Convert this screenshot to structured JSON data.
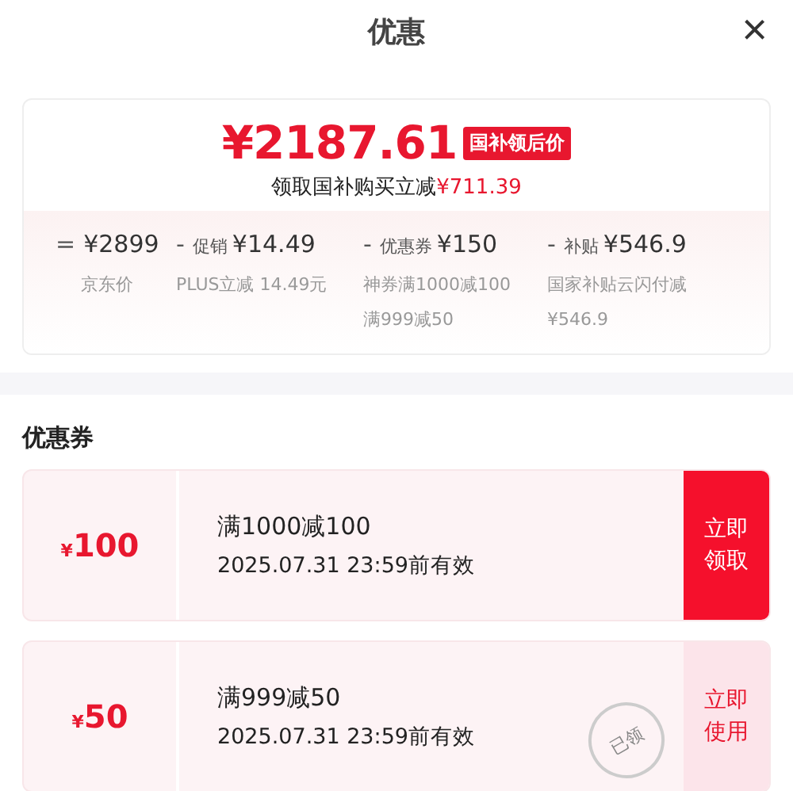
{
  "header": {
    "title": "优惠",
    "close": "×"
  },
  "summary": {
    "price": "¥2187.61",
    "badge": "国补领后价",
    "saving_text": "领取国补购买立减",
    "saving_amount": "¥711.39",
    "breakdown": [
      {
        "op": "=",
        "amount": "¥2899",
        "notes": [
          "京东价"
        ]
      },
      {
        "op": "-",
        "label": "促销",
        "amount": "¥14.49",
        "notes": [
          "PLUS立减 14.49元"
        ]
      },
      {
        "op": "-",
        "label": "优惠券",
        "amount": "¥150",
        "notes": [
          "神券满1000减100",
          "满999减50"
        ]
      },
      {
        "op": "-",
        "label": "补贴",
        "amount": "¥546.9",
        "notes": [
          "国家补贴云闪付减",
          "¥546.9"
        ]
      }
    ]
  },
  "coupons_section": {
    "title": "优惠券",
    "coupons": [
      {
        "currency": "¥",
        "value": "100",
        "condition": "满1000减100",
        "validity": "2025.07.31 23:59前有效",
        "action": "立即领取",
        "claimed": false
      },
      {
        "currency": "¥",
        "value": "50",
        "condition": "满999减50",
        "validity": "2025.07.31 23:59前有效",
        "action": "立即使用",
        "claimed": true,
        "stamp": "已领"
      }
    ]
  }
}
